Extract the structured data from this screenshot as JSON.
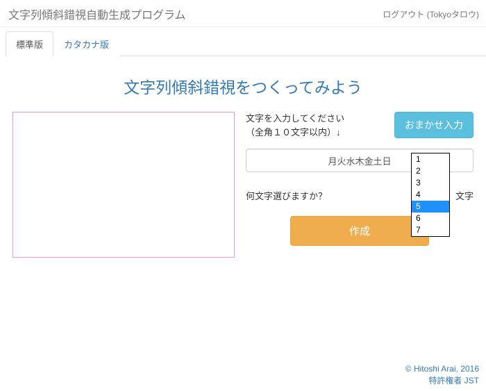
{
  "header": {
    "title": "文字列傾斜錯視自動生成プログラム",
    "logout_label": "ログアウト",
    "user": "Tokyoタロウ"
  },
  "tabs": {
    "standard": "標準版",
    "katakana": "カタカナ版"
  },
  "page_title": "文字列傾斜錯視をつくってみよう",
  "controls": {
    "instruction_line1": "文字を入力してください",
    "instruction_line2": "（全角１０文字以内）↓",
    "random_button": "おまかせ入力",
    "input_value": "月火水木金土日",
    "select_question": "何文字選びますか？",
    "select_suffix": "文字",
    "options": [
      "1",
      "2",
      "3",
      "4",
      "5",
      "6",
      "7"
    ],
    "selected": "5",
    "create_button": "作成"
  },
  "footer": {
    "copyright": "© Hitoshi Arai, 2016",
    "patent": "特許権者 JST"
  }
}
